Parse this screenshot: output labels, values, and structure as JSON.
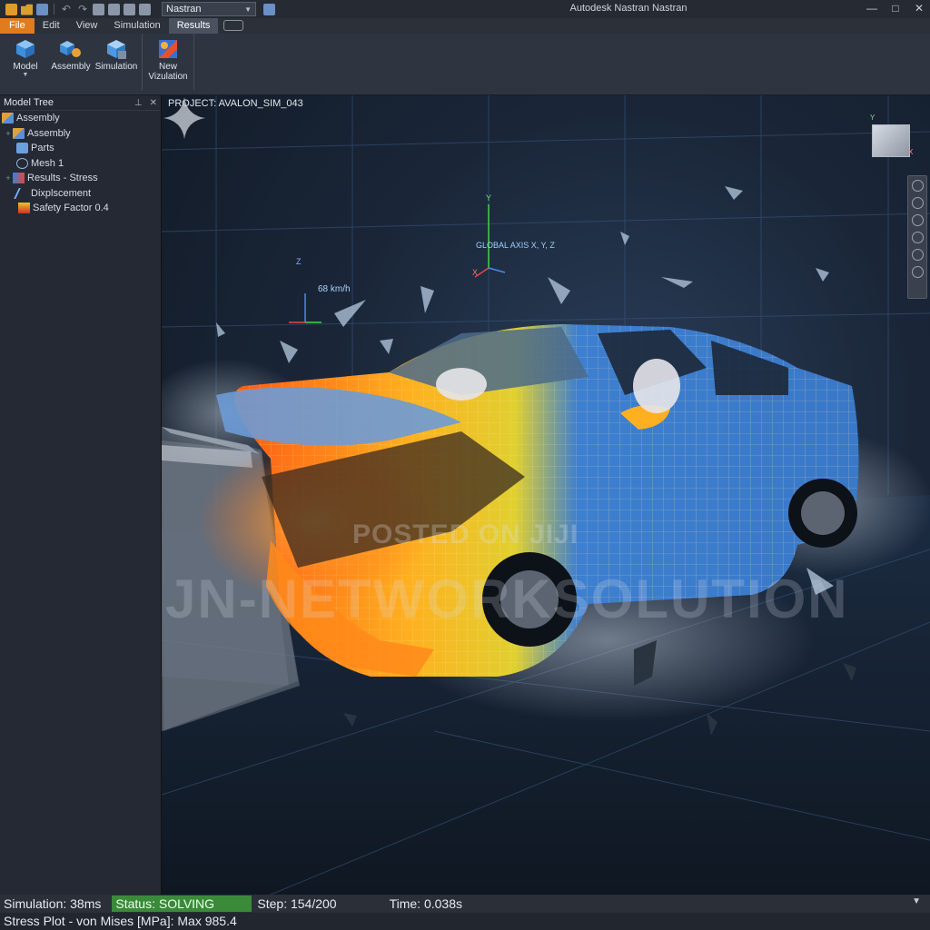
{
  "titlebar": {
    "app_select_value": "Nastran",
    "window_title": "Autodesk Nastran Nastran",
    "controls": {
      "minimize": "—",
      "maximize": "□",
      "close": "✕"
    }
  },
  "menu": {
    "items": [
      "File",
      "Edit",
      "View",
      "Simulation",
      "Results"
    ],
    "active": "Results"
  },
  "ribbon": {
    "model": "Model",
    "assembly": "Assembly",
    "simulation": "Simulation",
    "new_visualization": "New Vizulation"
  },
  "tree": {
    "title": "Model Tree",
    "items": [
      {
        "label": "Assembly",
        "icon": "assembly-icon"
      },
      {
        "label": "Assembly",
        "icon": "assembly-icon"
      },
      {
        "label": "Parts",
        "icon": "parts-icon"
      },
      {
        "label": "Mesh 1",
        "icon": "mesh-icon"
      },
      {
        "label": "Results - Stress",
        "icon": "results-icon"
      },
      {
        "label": "Dixplscement",
        "icon": "displacement-icon"
      },
      {
        "label": "Safety Factor 0.4",
        "icon": "safety-factor-icon"
      }
    ]
  },
  "viewport": {
    "project_label": "PROJECT: AVALON_SIM_043",
    "axis_label": "GLOBAL AXIS X, Y, Z",
    "speed_label": "68 km/h",
    "watermark_small": "POSTED ON JIJI",
    "watermark_large": "JN-NETWORKSOLUTION",
    "cube_axis_x": "X",
    "cube_axis_y": "Y",
    "axis_y": "Y",
    "axis_z": "Z",
    "axis_x": "X"
  },
  "status": {
    "simulation": "Simulation: 38ms",
    "state": "Status: SOLVING",
    "step": "Step: 154/200",
    "time": "Time: 0.038s",
    "plot": "Stress Plot - von Mises [MPa]: Max 985.4"
  },
  "colors": {
    "file_menu": "#e07c1e",
    "status_badge": "#3a8a3a",
    "stress_hot": "#ff7a1a",
    "stress_mid": "#ffd21a",
    "car_body": "#3d7fd0"
  }
}
